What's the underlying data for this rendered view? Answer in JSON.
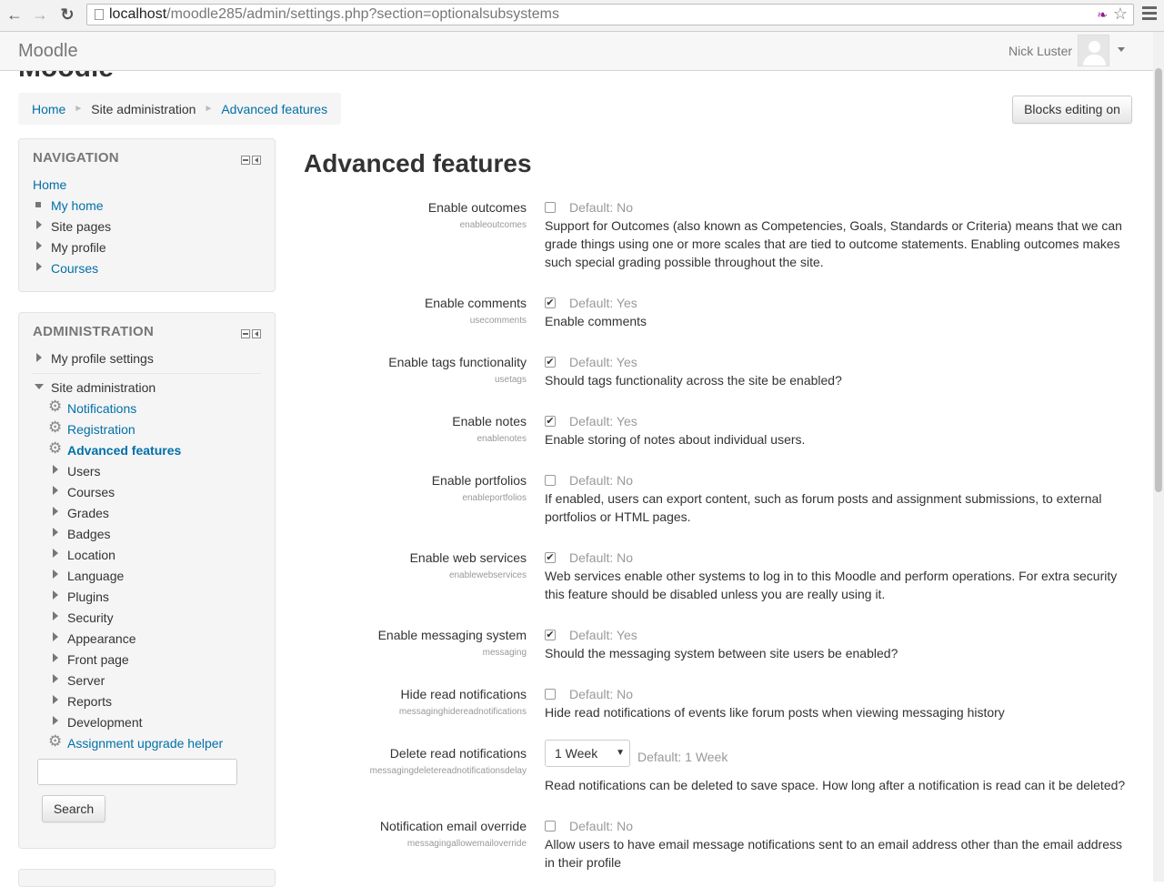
{
  "browser": {
    "url_host": "localhost",
    "url_path": "/moodle285/admin/settings.php?section=optionalsubsystems"
  },
  "navbar": {
    "brand": "Moodle",
    "user_name": "Nick Luster",
    "peek_title": "Moodle"
  },
  "breadcrumb": {
    "items": [
      "Home",
      "Site administration",
      "Advanced features"
    ]
  },
  "blocks_editing_button": "Blocks editing on",
  "navigation_block": {
    "title": "NAVIGATION",
    "home": "Home",
    "items": [
      "My home",
      "Site pages",
      "My profile",
      "Courses"
    ]
  },
  "administration_block": {
    "title": "ADMINISTRATION",
    "my_profile_settings": "My profile settings",
    "site_administration": "Site administration",
    "gear_items": [
      "Notifications",
      "Registration",
      "Advanced features"
    ],
    "folder_items": [
      "Users",
      "Courses",
      "Grades",
      "Badges",
      "Location",
      "Language",
      "Plugins",
      "Security",
      "Appearance",
      "Front page",
      "Server",
      "Reports",
      "Development"
    ],
    "assignment_helper": "Assignment upgrade helper",
    "search_value": "",
    "search_button": "Search"
  },
  "main": {
    "title": "Advanced features",
    "settings": [
      {
        "label": "Enable outcomes",
        "key": "enableoutcomes",
        "checked": false,
        "default": "Default: No",
        "description": "Support for Outcomes (also known as Competencies, Goals, Standards or Criteria) means that we can grade things using one or more scales that are tied to outcome statements. Enabling outcomes makes such special grading possible throughout the site."
      },
      {
        "label": "Enable comments",
        "key": "usecomments",
        "checked": true,
        "default": "Default: Yes",
        "description": "Enable comments"
      },
      {
        "label": "Enable tags functionality",
        "key": "usetags",
        "checked": true,
        "default": "Default: Yes",
        "description": "Should tags functionality across the site be enabled?"
      },
      {
        "label": "Enable notes",
        "key": "enablenotes",
        "checked": true,
        "default": "Default: Yes",
        "description": "Enable storing of notes about individual users."
      },
      {
        "label": "Enable portfolios",
        "key": "enableportfolios",
        "checked": false,
        "default": "Default: No",
        "description": "If enabled, users can export content, such as forum posts and assignment submissions, to external portfolios or HTML pages."
      },
      {
        "label": "Enable web services",
        "key": "enablewebservices",
        "checked": true,
        "default": "Default: No",
        "description": "Web services enable other systems to log in to this Moodle and perform operations. For extra security this feature should be disabled unless you are really using it."
      },
      {
        "label": "Enable messaging system",
        "key": "messaging",
        "checked": true,
        "default": "Default: Yes",
        "description": "Should the messaging system between site users be enabled?"
      },
      {
        "label": "Hide read notifications",
        "key": "messaginghidereadnotifications",
        "checked": false,
        "default": "Default: No",
        "description": "Hide read notifications of events like forum posts when viewing messaging history"
      },
      {
        "label": "Delete read notifications",
        "key": "messagingdeletereadnotificationsdelay",
        "select_value": "1 Week",
        "default": "Default: 1 Week",
        "description": "Read notifications can be deleted to save space. How long after a notification is read can it be deleted?"
      },
      {
        "label": "Notification email override",
        "key": "messagingallowemailoverride",
        "checked": false,
        "default": "Default: No",
        "description": "Allow users to have email message notifications sent to an email address other than the email address in their profile"
      }
    ]
  },
  "icons": {
    "check": "✔",
    "gear": "⚙",
    "back": "←",
    "forward": "→",
    "reload": "↻",
    "star": "☆",
    "feather": "❧",
    "select_arrow": "▼"
  }
}
